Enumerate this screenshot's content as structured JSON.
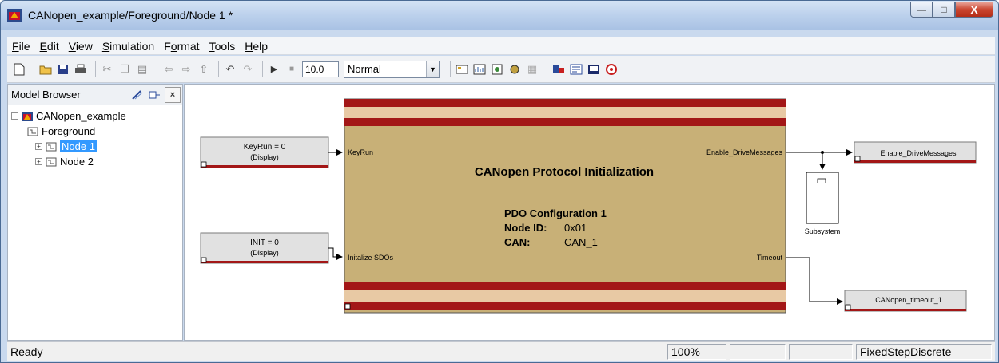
{
  "window": {
    "title": "CANopen_example/Foreground/Node 1 *",
    "controls": {
      "minimize": "—",
      "maximize": "□",
      "close": "X"
    }
  },
  "menu": [
    {
      "pre": "",
      "u": "F",
      "post": "ile"
    },
    {
      "pre": "",
      "u": "E",
      "post": "dit"
    },
    {
      "pre": "",
      "u": "V",
      "post": "iew"
    },
    {
      "pre": "",
      "u": "S",
      "post": "imulation"
    },
    {
      "pre": "F",
      "u": "o",
      "post": "rmat"
    },
    {
      "pre": "",
      "u": "T",
      "post": "ools"
    },
    {
      "pre": "",
      "u": "H",
      "post": "elp"
    }
  ],
  "toolbar": {
    "stop_time": "10.0",
    "sim_mode": "Normal"
  },
  "browser": {
    "title": "Model Browser",
    "tree": [
      {
        "label": "CANopen_example",
        "expander": "−",
        "level": 0
      },
      {
        "label": "Foreground",
        "expander": "",
        "level": 1
      },
      {
        "label": "Node 1",
        "expander": "+",
        "level": 2,
        "selected": true
      },
      {
        "label": "Node 2",
        "expander": "+",
        "level": 2
      }
    ]
  },
  "diagram": {
    "keyrun_block": {
      "line1": "KeyRun = 0",
      "line2": "(Display)"
    },
    "init_block": {
      "line1": "INIT = 0",
      "line2": "(Display)"
    },
    "main_block": {
      "title": "CANopen Protocol Initialization",
      "pdo_label": "PDO Configuration 1",
      "node_label": "Node ID:",
      "node_value": "0x01",
      "can_label": "CAN:",
      "can_value": "CAN_1",
      "in_port_1": "KeyRun",
      "in_port_2": "Initalize SDOs",
      "out_port_1": "Enable_DriveMessages",
      "out_port_2": "Timeout"
    },
    "subsystem": {
      "label": "Subsystem"
    },
    "out_block_1": {
      "label": "Enable_DriveMessages"
    },
    "out_block_2": {
      "label": "CANopen_timeout_1"
    },
    "colors": {
      "main_fill": "#c8b077",
      "stripe_dark": "#a31717",
      "stripe_light": "#e8c9a4",
      "block_fill": "#e1e1e1"
    }
  },
  "status": {
    "message": "Ready",
    "zoom": "100%",
    "solver": "FixedStepDiscrete"
  }
}
